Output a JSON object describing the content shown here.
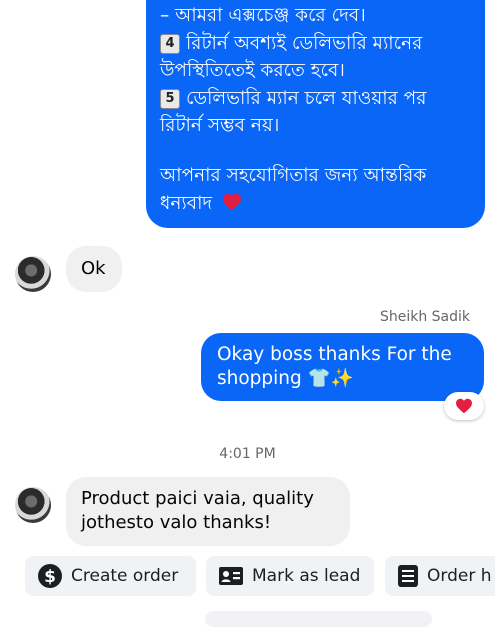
{
  "conversation": {
    "incoming_message_lines": [
      "– আমরা এক্সচেঞ্জ করে দেব।",
      "রিটার্ন অবশ্যই ডেলিভারি ম্যানের",
      "উপস্থিতিতেই করতে হবে।",
      "ডেলিভারি ম্যান চলে যাওয়ার পর",
      "রিটার্ন সম্ভব নয়।",
      "আপনার সহযোগিতার জন্য আন্তরিক",
      "ধন্যবাদ"
    ],
    "keycap_4": "4",
    "keycap_5": "5",
    "heart_emoji": "❤️",
    "ok_message": "Ok",
    "sender_name": "Sheikh Sadik",
    "thanks_message_line1": "Okay boss thanks For the",
    "thanks_message_line2": "shopping",
    "thanks_emojis": "👕✨",
    "reaction": "❤️",
    "timestamp": "4:01 PM",
    "product_message_line1": "Product paici vaia, quality",
    "product_message_line2": "jothesto valo thanks!"
  },
  "actions": {
    "create_order": "Create order",
    "mark_as_lead": "Mark as lead",
    "order_history": "Order h"
  },
  "colors": {
    "outgoing_bubble": "#0a66f7",
    "incoming_bubble": "#f0f0f0",
    "action_button": "#f0f2f5",
    "reaction_heart": "#e41e3f"
  },
  "icons": {
    "create_order": "dollar-circle-icon",
    "mark_as_lead": "contact-card-icon",
    "order_history": "receipt-list-icon"
  }
}
